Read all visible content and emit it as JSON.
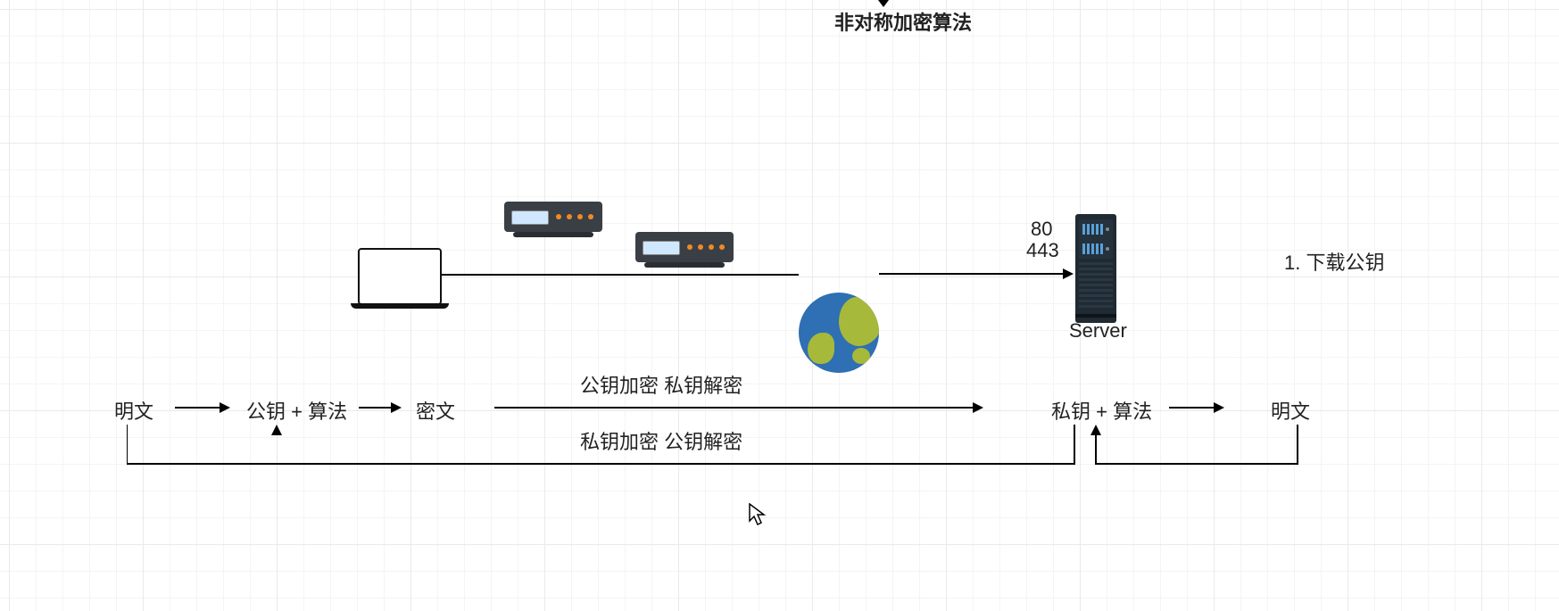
{
  "title": "非对称加密算法",
  "ports": {
    "http": "80",
    "https": "443"
  },
  "server_label": "Server",
  "step1": "1. 下载公钥",
  "flow": {
    "plaintext_left": "明文",
    "pubkey_algo": "公钥 + 算法",
    "ciphertext": "密文",
    "top_caption": "公钥加密  私钥解密",
    "bottom_caption": "私钥加密 公钥解密",
    "privkey_algo": "私钥 + 算法",
    "plaintext_right": "明文"
  },
  "chart_data": {
    "type": "diagram",
    "nodes": [
      {
        "id": "client",
        "kind": "laptop"
      },
      {
        "id": "router1",
        "kind": "router"
      },
      {
        "id": "router2",
        "kind": "router"
      },
      {
        "id": "internet",
        "kind": "globe"
      },
      {
        "id": "server",
        "kind": "server",
        "ports": [
          80,
          443
        ],
        "label": "Server"
      }
    ],
    "edges": [
      {
        "from": "client",
        "to": "internet",
        "style": "line"
      },
      {
        "from": "internet",
        "to": "server",
        "style": "arrow"
      }
    ],
    "encryption_flow": [
      {
        "label": "明文"
      },
      {
        "arrow": "right"
      },
      {
        "label": "公钥 + 算法"
      },
      {
        "arrow": "right"
      },
      {
        "label": "密文"
      },
      {
        "arrow": "right",
        "caption_top": "公钥加密  私钥解密",
        "caption_bottom": "私钥加密 公钥解密",
        "bidirectional": true
      },
      {
        "label": "私钥 + 算法"
      },
      {
        "arrow": "right"
      },
      {
        "label": "明文"
      }
    ],
    "feedback_arrows": [
      {
        "from": "明文(left)",
        "to": "公钥 + 算法",
        "shape": "L-up"
      },
      {
        "from": "明文(right)",
        "to": "私钥 + 算法",
        "shape": "L-up"
      }
    ],
    "annotations": [
      {
        "text": "非对称加密算法",
        "pos": "top",
        "style": "bold"
      },
      {
        "text": "1. 下载公钥",
        "pos": "right"
      }
    ]
  }
}
